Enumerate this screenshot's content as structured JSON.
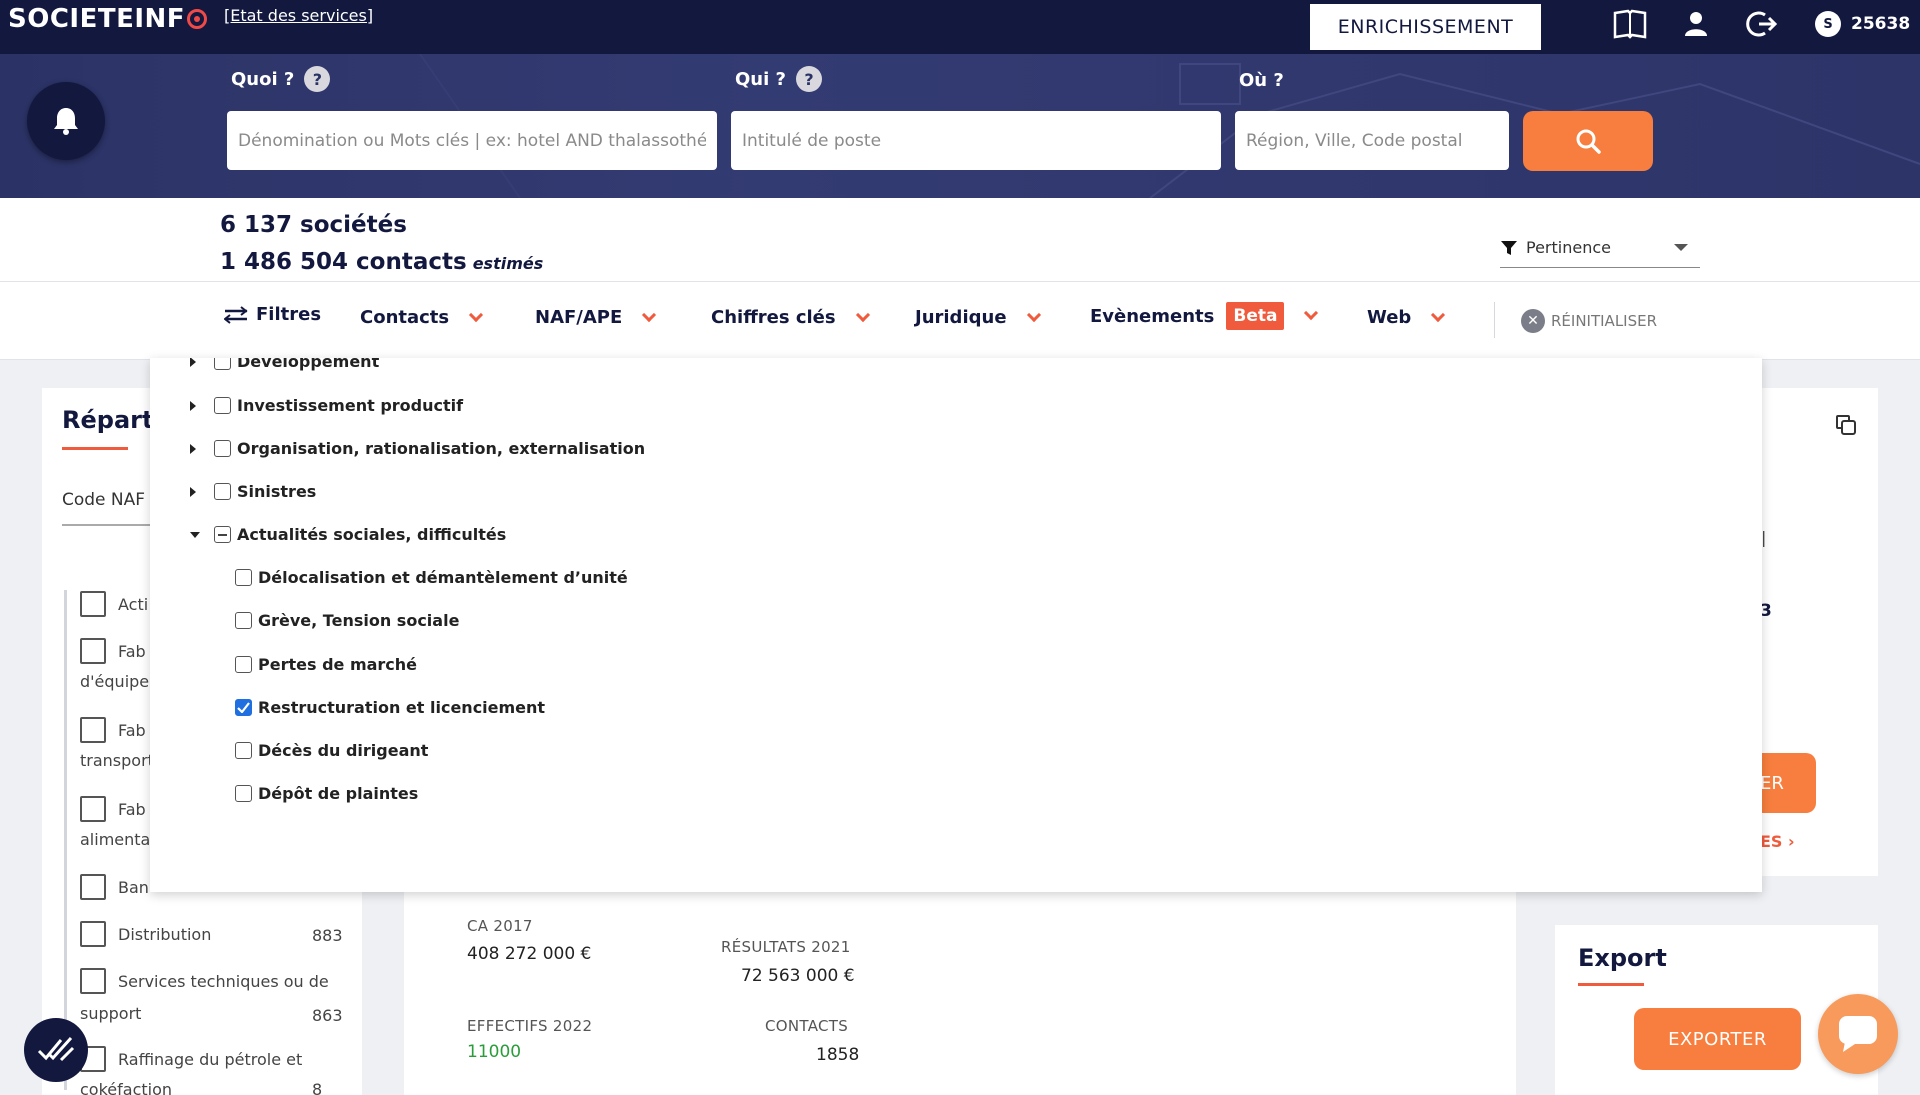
{
  "header": {
    "logo_text": "SOCIETEINF",
    "status_link": "[Etat des services]",
    "enrich_label": "ENRICHISSEMENT",
    "credits_coin": "S",
    "credits": "25638"
  },
  "search": {
    "quoi_label": "Quoi ?",
    "qui_label": "Qui ?",
    "ou_label": "Où ?",
    "help_glyph": "?",
    "quoi_placeholder": "Dénomination ou Mots clés | ex: hotel AND thalassothérapie",
    "qui_placeholder": "Intitulé de poste",
    "ou_placeholder": "Région, Ville, Code postal"
  },
  "results": {
    "companies": "6 137 sociétés",
    "contacts": "1 486 504 contacts",
    "estimated": "estimés",
    "sort_label": "Pertinence"
  },
  "filters": {
    "filtres": "Filtres",
    "contacts": "Contacts",
    "naf": "NAF/APE",
    "chiffres": "Chiffres clés",
    "juridique": "Juridique",
    "evenements": "Evènements",
    "beta": "Beta",
    "web": "Web",
    "reset": "RÉINITIALISER"
  },
  "dropdown": {
    "items": [
      {
        "label": "Developpement",
        "state": "unchecked",
        "expanded": false
      },
      {
        "label": "Investissement productif",
        "state": "unchecked",
        "expanded": false
      },
      {
        "label": "Organisation, rationalisation, externalisation",
        "state": "unchecked",
        "expanded": false
      },
      {
        "label": "Sinistres",
        "state": "unchecked",
        "expanded": false
      },
      {
        "label": "Actualités sociales, difficultés",
        "state": "indeterminate",
        "expanded": true
      }
    ],
    "subitems": [
      {
        "label": "Délocalisation et démantèlement d’unité",
        "checked": false
      },
      {
        "label": "Grève, Tension sociale",
        "checked": false
      },
      {
        "label": "Pertes de marché",
        "checked": false
      },
      {
        "label": "Restructuration et licenciement",
        "checked": true
      },
      {
        "label": "Décès du dirigeant",
        "checked": false
      },
      {
        "label": "Dépôt de plaintes",
        "checked": false
      }
    ]
  },
  "left_panel": {
    "title": "Répart",
    "code_naf": "Code NAF",
    "items": [
      {
        "label": "Acti",
        "sub": "",
        "count": ""
      },
      {
        "label": "Fab",
        "sub": "d'équipe",
        "count": ""
      },
      {
        "label": "Fab",
        "sub": "transport",
        "count": ""
      },
      {
        "label": "Fab",
        "sub": "alimenta",
        "count": ""
      },
      {
        "label": "Ban",
        "sub": "",
        "count": ""
      },
      {
        "label": "Distribution",
        "sub": "",
        "count": "883"
      },
      {
        "label": "Services techniques ou de",
        "sub": "support",
        "count": "863"
      },
      {
        "label": "Raffinage du pétrole et",
        "sub": "cokéfaction",
        "count": "8"
      }
    ]
  },
  "right_panel": {
    "bar_text": "|",
    "number_fragment": "3",
    "button_fragment": "ER",
    "link_fragment": "ES ›"
  },
  "stats": {
    "ca_label": "CA 2017",
    "ca_value": "408 272 000 €",
    "res_label": "RÉSULTATS 2021",
    "res_value": "72 563 000 €",
    "eff_label": "EFFECTIFS 2022",
    "eff_value": "11000",
    "contacts_label": "CONTACTS",
    "contacts_value": "1858"
  },
  "export": {
    "title": "Export",
    "button": "EXPORTER"
  },
  "colors": {
    "navy": "#13183f",
    "accent": "#f77e3e",
    "red": "#ef5b3c",
    "checkbox_blue": "#1f6fe0"
  }
}
